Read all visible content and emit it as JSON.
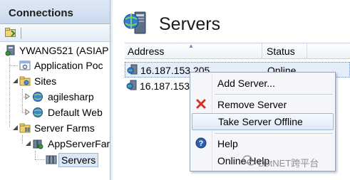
{
  "connections_pane": {
    "title": "Connections",
    "tree": {
      "server": "YWANG521 (ASIAP",
      "app_pools": "Application Poc",
      "sites": "Sites",
      "site_1": "agilesharp",
      "site_2": "Default Web",
      "server_farms": "Server Farms",
      "farm": "AppServerFar",
      "servers": "Servers"
    }
  },
  "main": {
    "title": "Servers",
    "columns": {
      "address": "Address",
      "status": "Status"
    },
    "rows": [
      {
        "address": "16.187.153.205",
        "status": "Online"
      },
      {
        "address": "16.187.153.",
        "status": ""
      }
    ]
  },
  "context_menu": {
    "items": [
      {
        "label": "Add Server..."
      },
      {
        "label": "Remove Server"
      },
      {
        "label": "Take Server Offline"
      },
      {
        "label": "Help"
      },
      {
        "label": "Online Help"
      }
    ]
  },
  "watermark": {
    "text": "DotNET跨平台"
  },
  "colors": {
    "selection": "#e4edf9",
    "menu_highlight": "#deeaf8",
    "header_gradient_top": "#dfe9f5",
    "remove_red": "#d9301f",
    "help_blue": "#2c5fb0"
  }
}
